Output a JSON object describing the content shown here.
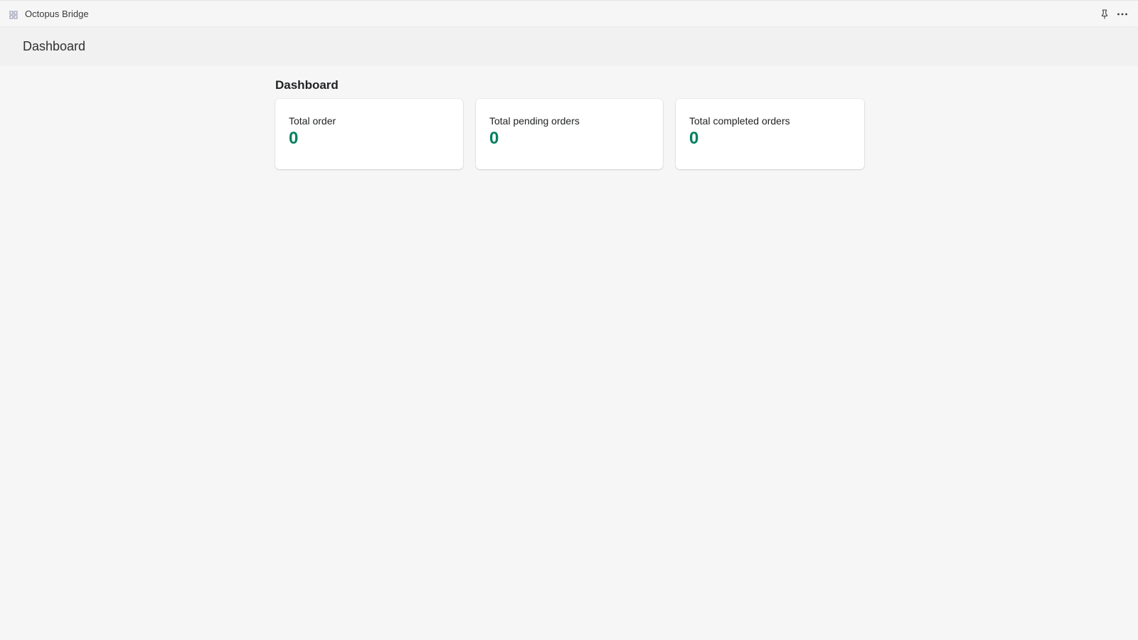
{
  "app": {
    "title": "Octopus Bridge",
    "icon": "app-grid-icon"
  },
  "titlebar": {
    "pin_icon": "pin-icon",
    "more_icon": "more-actions-icon"
  },
  "header": {
    "title": "Dashboard"
  },
  "main": {
    "section_title": "Dashboard",
    "cards": [
      {
        "label": "Total order",
        "value": "0"
      },
      {
        "label": "Total pending orders",
        "value": "0"
      },
      {
        "label": "Total completed orders",
        "value": "0"
      }
    ]
  },
  "colors": {
    "accent_value": "#008060",
    "background": "#f6f6f7",
    "header_background": "#f1f1f1",
    "card_background": "#ffffff"
  }
}
